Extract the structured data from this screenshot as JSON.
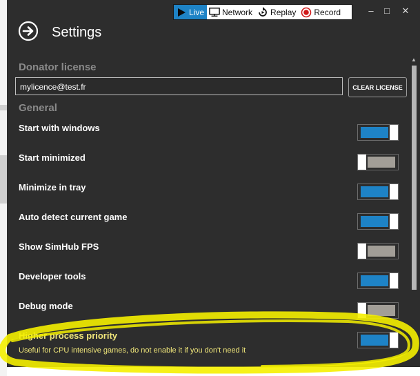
{
  "modes": [
    {
      "label": "Live",
      "icon": "play-icon",
      "active": true
    },
    {
      "label": "Network",
      "icon": "network-icon",
      "active": false
    },
    {
      "label": "Replay",
      "icon": "replay-icon",
      "active": false
    },
    {
      "label": "Record",
      "icon": "record-icon",
      "active": false
    }
  ],
  "window_controls": {
    "minimize": "–",
    "maximize": "□",
    "close": "✕"
  },
  "header": {
    "title": "Settings"
  },
  "donator": {
    "section": "Donator license",
    "email": "mylicence@test.fr",
    "clear_label": "CLEAR LICENSE"
  },
  "general": {
    "section": "General",
    "settings": [
      {
        "label": "Start with windows",
        "enabled": true
      },
      {
        "label": "Start minimized",
        "enabled": false
      },
      {
        "label": "Minimize in tray",
        "enabled": true
      },
      {
        "label": "Auto detect current game",
        "enabled": true
      },
      {
        "label": "Show SimHub FPS",
        "enabled": false
      },
      {
        "label": "Developer tools",
        "enabled": true
      },
      {
        "label": "Debug mode",
        "enabled": false
      },
      {
        "label": "Higher process priority",
        "enabled": true,
        "highlighted": true,
        "hint": "Useful for CPU intensive games, do not enable it if you don't need it"
      }
    ]
  },
  "colors": {
    "accent": "#1e83c6",
    "window_bg": "#2d2d2d",
    "highlight": "#f5f000",
    "hint_text": "#f0e67a"
  }
}
